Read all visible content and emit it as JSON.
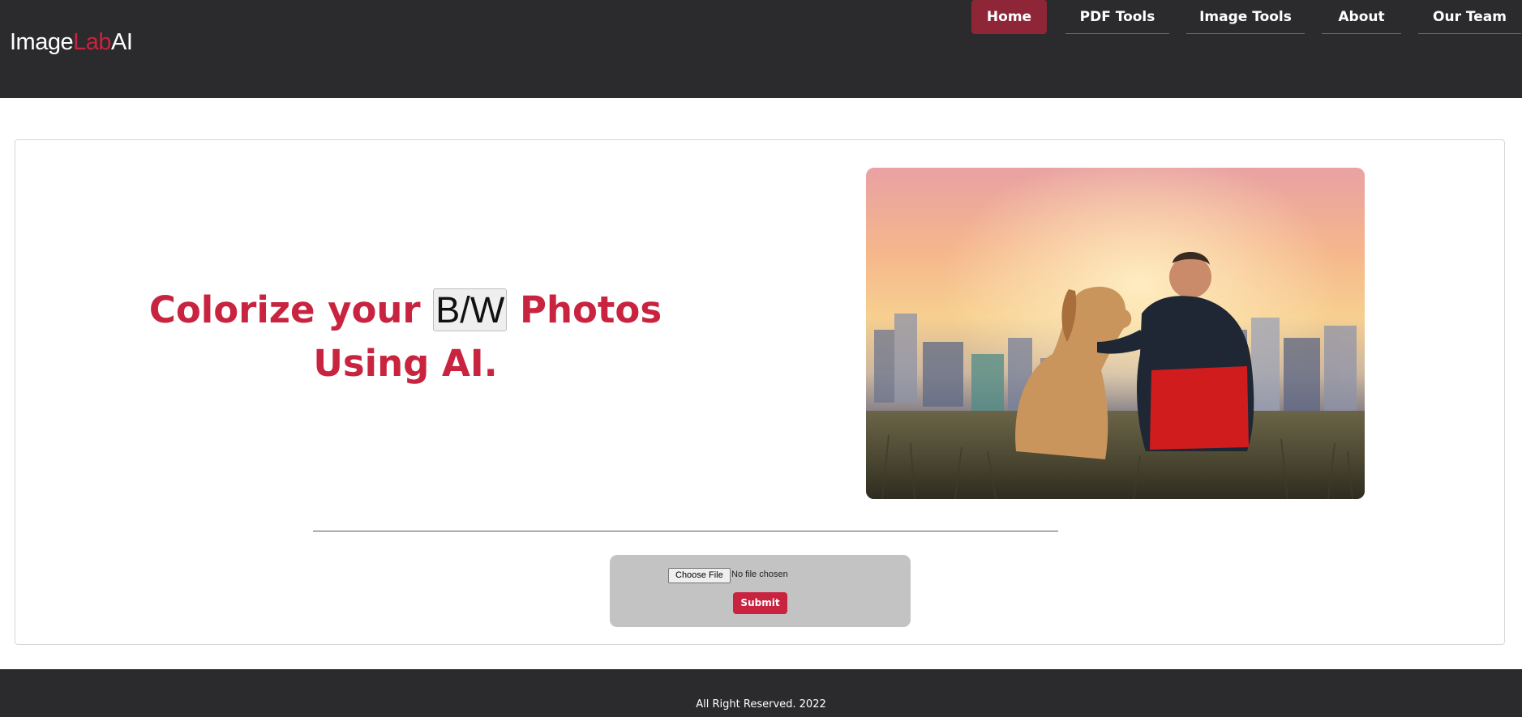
{
  "brand": {
    "part1": "Image",
    "part2": "Lab",
    "part3": "AI"
  },
  "nav": {
    "items": [
      {
        "label": "Home",
        "active": true
      },
      {
        "label": "PDF Tools",
        "active": false
      },
      {
        "label": "Image Tools",
        "active": false
      },
      {
        "label": "About",
        "active": false
      },
      {
        "label": "Our Team",
        "active": false
      }
    ]
  },
  "hero": {
    "headline_before": "Colorize your",
    "headline_highlight": "B/W",
    "headline_after": "Photos Using AI."
  },
  "photo": {
    "subject": "man-and-dog-at-sunset-photo"
  },
  "upload": {
    "choose_label": "Choose File",
    "status": "No file chosen",
    "submit_label": "Submit"
  },
  "footer": {
    "text": "All Right Reserved. 2022"
  },
  "colors": {
    "accent": "#c8233f",
    "header_bg": "#2b2b2d",
    "active_nav": "#8e2637",
    "upload_bg": "#c4c3c4"
  }
}
